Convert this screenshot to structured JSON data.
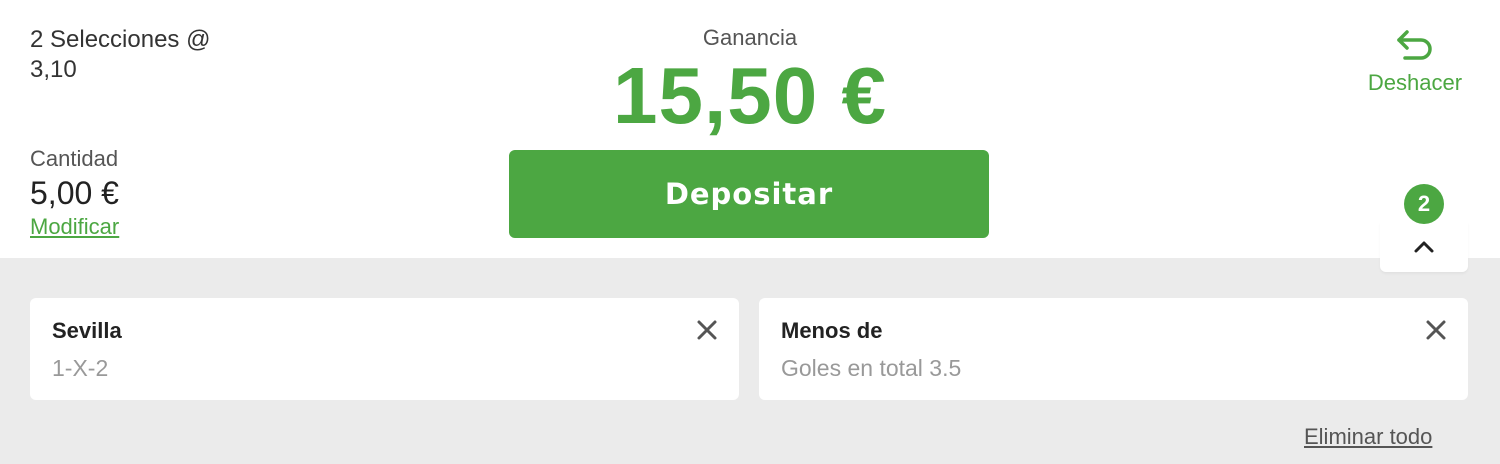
{
  "summary": {
    "selections_line1": "2 Selecciones @",
    "selections_line2": "3,10",
    "stake_label": "Cantidad",
    "stake_value": "5,00 €",
    "modify_label": "Modificar"
  },
  "winnings": {
    "label": "Ganancia",
    "value": "15,50 €"
  },
  "deposit_button": {
    "label": "Depositar"
  },
  "undo": {
    "label": "Deshacer",
    "icon": "undo-icon"
  },
  "collapse": {
    "count": "2",
    "icon": "chevron-up-icon"
  },
  "selections": [
    {
      "title": "Sevilla",
      "market": "1-X-2",
      "close_icon": "close-icon"
    },
    {
      "title": "Menos de",
      "market": "Goles en total 3.5",
      "close_icon": "close-icon"
    }
  ],
  "remove_all_label": "Eliminar todo",
  "colors": {
    "accent": "#4ca742",
    "panel": "#ebebeb"
  }
}
